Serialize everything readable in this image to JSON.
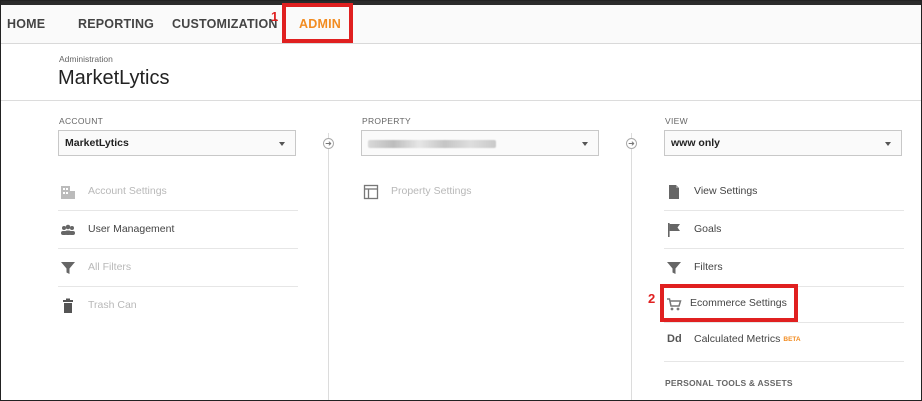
{
  "nav": {
    "items": [
      "HOME",
      "REPORTING",
      "CUSTOMIZATION",
      "ADMIN"
    ],
    "active": "ADMIN"
  },
  "header": {
    "crumb": "Administration",
    "title": "MarketLytics"
  },
  "account": {
    "label": "ACCOUNT",
    "selected": "MarketLytics",
    "items": [
      {
        "label": "Account Settings",
        "icon": "building-icon",
        "disabled": true
      },
      {
        "label": "User Management",
        "icon": "users-icon",
        "disabled": false
      },
      {
        "label": "All Filters",
        "icon": "filter-icon",
        "disabled": true
      },
      {
        "label": "Trash Can",
        "icon": "trash-icon",
        "disabled": true
      }
    ]
  },
  "property": {
    "label": "PROPERTY",
    "selected": "",
    "items": [
      {
        "label": "Property Settings",
        "icon": "property-settings-icon",
        "disabled": true
      }
    ]
  },
  "view": {
    "label": "VIEW",
    "selected": "www only",
    "items": [
      {
        "label": "View Settings",
        "icon": "document-icon",
        "disabled": false
      },
      {
        "label": "Goals",
        "icon": "flag-icon",
        "disabled": false
      },
      {
        "label": "Filters",
        "icon": "filter-icon",
        "disabled": false
      },
      {
        "label": "Ecommerce Settings",
        "icon": "cart-icon",
        "disabled": false
      },
      {
        "label": "Calculated Metrics",
        "icon": "dd-icon",
        "disabled": false,
        "badge": "BETA"
      }
    ],
    "section_heading": "PERSONAL TOOLS & ASSETS"
  },
  "annotations": [
    "1",
    "2"
  ],
  "colors": {
    "accent": "#f28c21",
    "annotation": "#e02020",
    "disabled_text": "#b8b8b8"
  }
}
